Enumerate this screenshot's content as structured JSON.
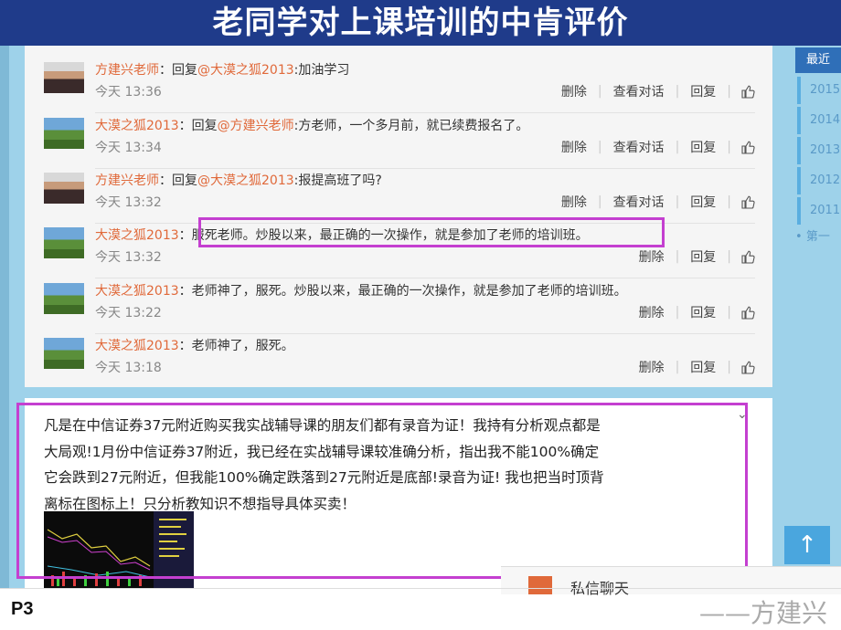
{
  "slide": {
    "title": "老同学对上课培训的中肯评价",
    "page_label": "P3",
    "signature": "——方建兴"
  },
  "comments": [
    {
      "author": "方建兴老师",
      "sep": "：",
      "prefix": "回复",
      "mention": "@大漠之狐2013",
      "text": ":加油学习",
      "time": "今天 13:36",
      "actions": [
        "删除",
        "查看对话",
        "回复"
      ],
      "avatar": "person"
    },
    {
      "author": "大漠之狐2013",
      "sep": "：",
      "prefix": "回复",
      "mention": "@方建兴老师",
      "text": ":方老师，一个多月前，就已续费报名了。",
      "time": "今天 13:34",
      "actions": [
        "删除",
        "查看对话",
        "回复"
      ],
      "avatar": "landscape"
    },
    {
      "author": "方建兴老师",
      "sep": "：",
      "prefix": "回复",
      "mention": "@大漠之狐2013",
      "text": ":报提高班了吗?",
      "time": "今天 13:32",
      "actions": [
        "删除",
        "查看对话",
        "回复"
      ],
      "avatar": "person"
    },
    {
      "author": "大漠之狐2013",
      "sep": "：",
      "prefix": "",
      "mention": "",
      "text": "服死老师。炒股以来，最正确的一次操作，就是参加了老师的培训班。",
      "time": "今天 13:32",
      "actions": [
        "删除",
        "回复"
      ],
      "avatar": "landscape"
    },
    {
      "author": "大漠之狐2013",
      "sep": "：",
      "prefix": "",
      "mention": "",
      "text": "老师神了，服死。炒股以来，最正确的一次操作，就是参加了老师的培训班。",
      "time": "今天 13:22",
      "actions": [
        "删除",
        "回复"
      ],
      "avatar": "landscape"
    },
    {
      "author": "大漠之狐2013",
      "sep": "：",
      "prefix": "",
      "mention": "",
      "text": "老师神了，服死。",
      "time": "今天 13:18",
      "actions": [
        "删除",
        "回复"
      ],
      "avatar": "landscape"
    }
  ],
  "post": {
    "lines": [
      "凡是在中信证券37元附近购买我实战辅导课的朋友们都有录音为证！我持有分析观点都是",
      "大局观!1月份中信证券37附近，我已经在实战辅导课较准确分析，指出我不能100%确定",
      "它会跌到27元附近，但我能100%确定跌落到27元附近是底部!录音为证! 我也把当时顶背",
      "离标在图标上！只分析教知识不想指导具体买卖！"
    ],
    "chevron": "⌄"
  },
  "sidebar": {
    "tab_label": "最近",
    "years": [
      "2015",
      "2014",
      "2013",
      "2012",
      "2011"
    ],
    "more_label": "第一"
  },
  "back_to_top_icon": "↑",
  "message_popup": {
    "label": "私信聊天"
  },
  "colors": {
    "title_bar": "#1f3b8a",
    "background": "#9ed2ea",
    "author": "#e0693a",
    "highlight_border": "#c43fd0",
    "accent_blue": "#2f6fb8"
  }
}
